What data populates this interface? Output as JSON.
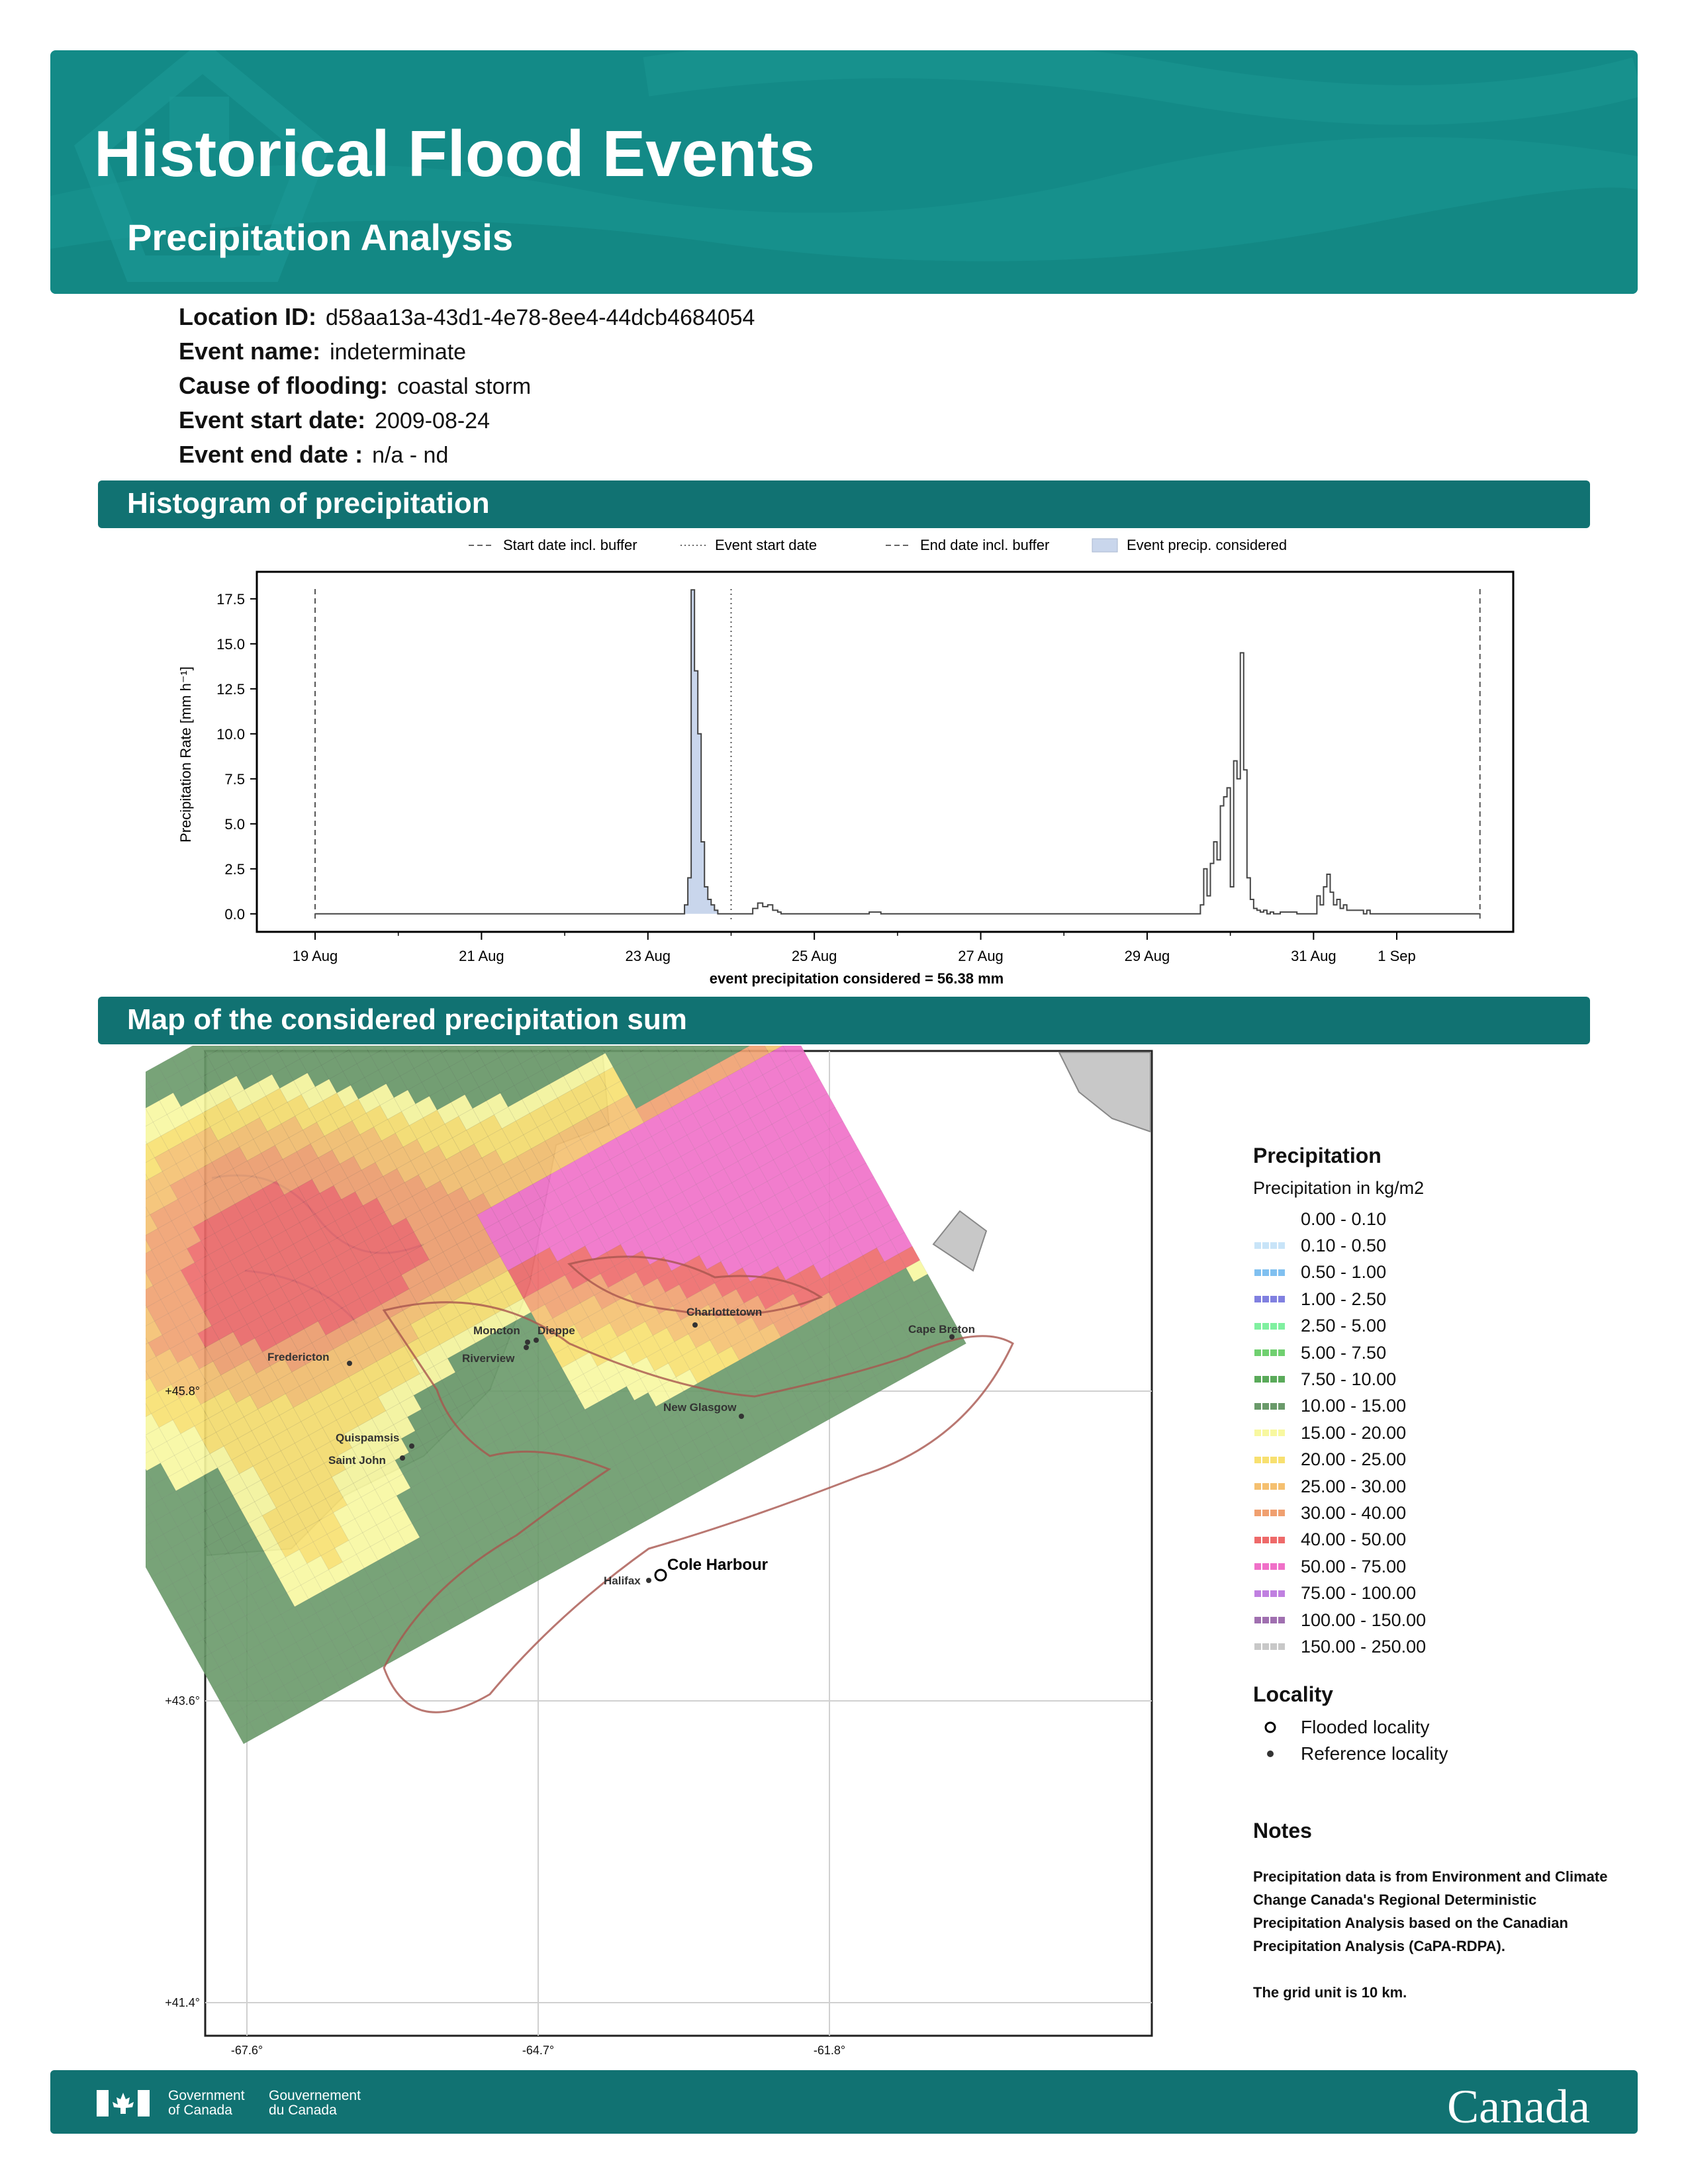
{
  "header": {
    "title": "Historical Flood Events",
    "subtitle": "Precipitation Analysis"
  },
  "info": [
    {
      "label": "Location ID:",
      "value": "d58aa13a-43d1-4e78-8ee4-44dcb4684054"
    },
    {
      "label": "Event name:",
      "value": "indeterminate"
    },
    {
      "label": "Cause of flooding:",
      "value": "coastal storm"
    },
    {
      "label": "Event start date:",
      "value": "2009-08-24"
    },
    {
      "label": "Event end date :",
      "value": "n/a - nd"
    }
  ],
  "sections": {
    "histogram": "Histogram of precipitation",
    "map": "Map of the considered precipitation sum"
  },
  "chart_data": {
    "type": "area",
    "ylabel": "Precipitation Rate [mm h⁻¹]",
    "xlabel": "event precipitation considered = 56.38 mm",
    "ylim": [
      -1.0,
      19.0
    ],
    "xlim": [
      -0.35,
      7.2
    ],
    "yticks": [
      0.0,
      2.5,
      5.0,
      7.5,
      10.0,
      12.5,
      15.0,
      17.5
    ],
    "ytick_labels": [
      "0.0",
      "2.5",
      "5.0",
      "7.5",
      "10.0",
      "12.5",
      "15.0",
      "17.5"
    ],
    "xticks": [
      0,
      1,
      2,
      3,
      4,
      5,
      6,
      7
    ],
    "xtick_labels": [
      "19 Aug",
      "21 Aug",
      "23 Aug",
      "25 Aug",
      "27 Aug",
      "29 Aug",
      "31 Aug",
      "1 Sep"
    ],
    "xtick_values": [
      0,
      1,
      2,
      3,
      4,
      5,
      6,
      6.5
    ],
    "minor_xticks": [
      0.5,
      1.5,
      2.5,
      3.5,
      4.5,
      5.5
    ],
    "legend_position": "top-center",
    "legend": [
      {
        "label": "Start date incl. buffer",
        "style": "dashed"
      },
      {
        "label": "Event start date",
        "style": "dotted"
      },
      {
        "label": "End date incl. buffer",
        "style": "dashed"
      },
      {
        "label": "Event precip. considered",
        "style": "fill"
      }
    ],
    "vlines": {
      "start_buffer": 0.0,
      "event_start": 2.5,
      "end_buffer": 7.0
    },
    "considered_range": [
      0.0,
      2.5
    ],
    "series": [
      {
        "x": [
          0.0,
          2.2,
          2.22,
          2.24,
          2.26,
          2.28,
          2.3,
          2.32,
          2.34,
          2.36,
          2.38,
          2.4,
          2.42,
          2.5,
          2.6,
          2.63,
          2.66,
          2.69,
          2.72,
          2.75,
          2.78,
          2.8,
          3.0,
          3.3,
          3.33,
          3.36,
          3.4,
          5.3,
          5.32,
          5.34,
          5.36,
          5.38,
          5.4,
          5.42,
          5.44,
          5.46,
          5.48,
          5.5,
          5.52,
          5.54,
          5.56,
          5.58,
          5.6,
          5.62,
          5.64,
          5.66,
          5.68,
          5.7,
          5.72,
          5.74,
          5.76,
          5.8,
          5.9,
          6.0,
          6.02,
          6.04,
          6.06,
          6.08,
          6.1,
          6.12,
          6.14,
          6.16,
          6.18,
          6.2,
          6.3,
          6.32,
          6.34,
          6.5,
          7.0
        ],
        "y": [
          0.0,
          0.0,
          0.5,
          2.0,
          18.0,
          13.5,
          10.0,
          4.0,
          1.5,
          0.8,
          0.5,
          0.2,
          0.0,
          0.0,
          0.0,
          0.3,
          0.6,
          0.4,
          0.5,
          0.2,
          0.1,
          0.0,
          0.0,
          0.0,
          0.1,
          0.1,
          0.0,
          0.0,
          0.5,
          2.5,
          1.0,
          2.8,
          4.0,
          3.0,
          6.0,
          6.5,
          7.0,
          1.5,
          8.5,
          7.5,
          14.5,
          8.0,
          2.0,
          0.8,
          0.3,
          0.2,
          0.1,
          0.2,
          0.0,
          0.1,
          0.0,
          0.1,
          0.0,
          0.0,
          1.0,
          0.5,
          1.5,
          2.2,
          1.2,
          0.5,
          0.8,
          0.3,
          0.5,
          0.2,
          0.0,
          0.2,
          0.0,
          0.0,
          0.0
        ]
      }
    ]
  },
  "map": {
    "lat_labels": [
      "+45.8°",
      "+43.6°",
      "+41.4°"
    ],
    "lon_labels": [
      "-67.6°",
      "-64.7°",
      "-61.8°"
    ],
    "places": [
      {
        "name": "Charlottetown"
      },
      {
        "name": "Moncton"
      },
      {
        "name": "Dieppe"
      },
      {
        "name": "Riverview"
      },
      {
        "name": "Fredericton"
      },
      {
        "name": "Cape Breton"
      },
      {
        "name": "New Glasgow"
      },
      {
        "name": "Quispamsis"
      },
      {
        "name": "Saint John"
      },
      {
        "name": "Halifax"
      },
      {
        "name": "Cole Harbour"
      }
    ]
  },
  "legend": {
    "title": "Precipitation",
    "subtitle": "Precipitation in kg/m2",
    "classes": [
      {
        "label": "0.00 - 0.10",
        "color": "#ffffff"
      },
      {
        "label": "0.10 - 0.50",
        "color": "#c8e4f8"
      },
      {
        "label": "0.50 - 1.00",
        "color": "#80c0f0"
      },
      {
        "label": "1.00 - 2.50",
        "color": "#8080e0"
      },
      {
        "label": "2.50 - 5.00",
        "color": "#80f0a0"
      },
      {
        "label": "5.00 - 7.50",
        "color": "#70d070"
      },
      {
        "label": "7.50 - 10.00",
        "color": "#5aaa5a"
      },
      {
        "label": "10.00 - 15.00",
        "color": "#6a9a6a"
      },
      {
        "label": "15.00 - 20.00",
        "color": "#f8f8a0"
      },
      {
        "label": "20.00 - 25.00",
        "color": "#f8e070"
      },
      {
        "label": "25.00 - 30.00",
        "color": "#f5c070"
      },
      {
        "label": "30.00 - 40.00",
        "color": "#f0a070"
      },
      {
        "label": "40.00 - 50.00",
        "color": "#ee6a6a"
      },
      {
        "label": "50.00 - 75.00",
        "color": "#f070c8"
      },
      {
        "label": "75.00 - 100.00",
        "color": "#c080e0"
      },
      {
        "label": "100.00 - 150.00",
        "color": "#a070b0"
      },
      {
        "label": "150.00 - 250.00",
        "color": "#c8c8c8"
      }
    ],
    "locality_title": "Locality",
    "localities": [
      {
        "label": "Flooded locality",
        "marker": "hollow-circle"
      },
      {
        "label": "Reference locality",
        "marker": "dot"
      }
    ]
  },
  "notes": {
    "title": "Notes",
    "text": "Precipitation data is from Environment and Climate Change Canada's Regional Deterministic Precipitation Analysis based on the Canadian Precipitation Analysis (CaPA-RDPA).\n\nThe grid unit is 10 km."
  },
  "footer": {
    "gov_en": "Government\nof Canada",
    "gov_fr": "Gouvernement\ndu Canada",
    "wordmark": "Canada",
    "flag_icon": "canada-flag-icon"
  }
}
